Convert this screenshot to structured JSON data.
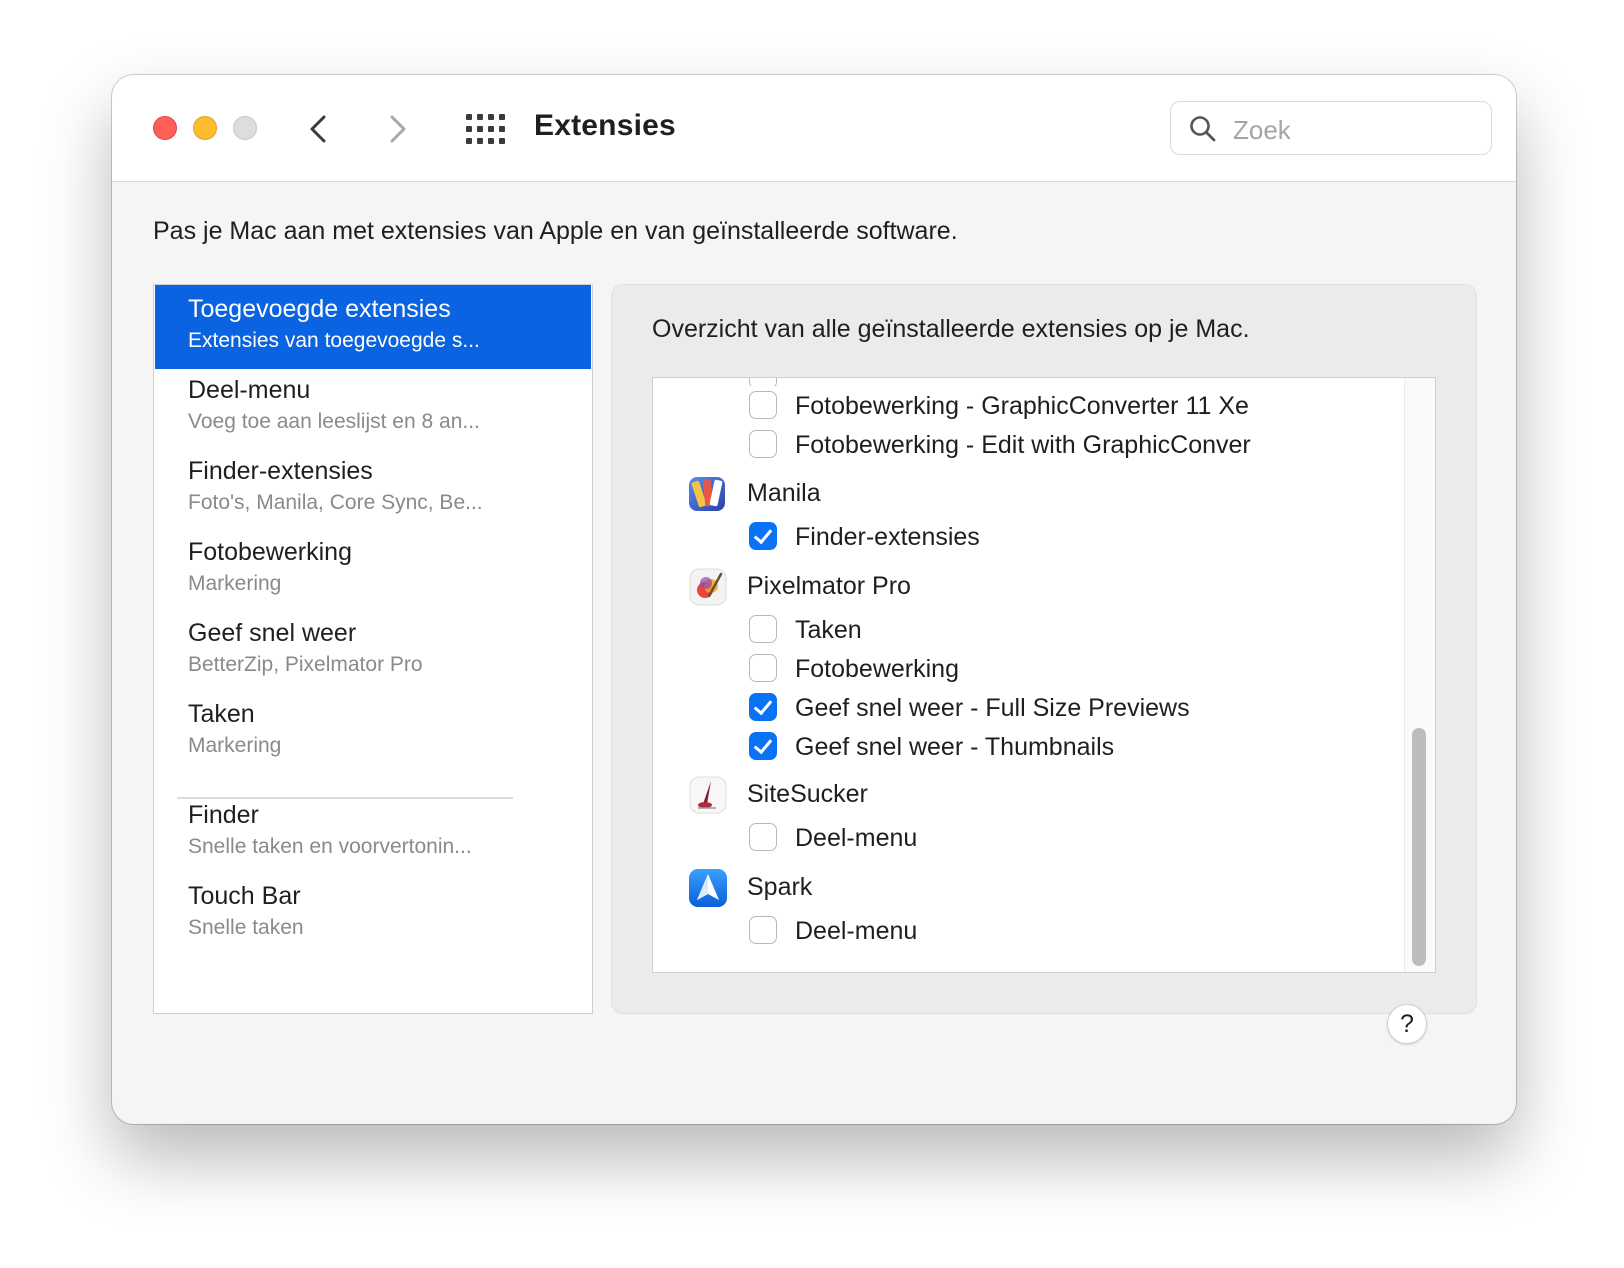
{
  "window": {
    "title": "Extensies"
  },
  "search": {
    "placeholder": "Zoek"
  },
  "description": "Pas je Mac aan met extensies van Apple en van geïnstalleerde software.",
  "sidebar": {
    "items": [
      {
        "title": "Toegevoegde extensies",
        "subtitle": "Extensies van toegevoegde s...",
        "selected": true
      },
      {
        "title": "Deel-menu",
        "subtitle": "Voeg toe aan leeslijst en 8 an..."
      },
      {
        "title": "Finder-extensies",
        "subtitle": "Foto's, Manila, Core Sync, Be..."
      },
      {
        "title": "Fotobewerking",
        "subtitle": "Markering"
      },
      {
        "title": "Geef snel weer",
        "subtitle": "BetterZip, Pixelmator Pro"
      },
      {
        "title": "Taken",
        "subtitle": "Markering"
      }
    ],
    "system_items": [
      {
        "title": "Finder",
        "subtitle": "Snelle taken en voorvertonin..."
      },
      {
        "title": "Touch Bar",
        "subtitle": "Snelle taken"
      }
    ]
  },
  "panel": {
    "title": "Overzicht van alle geïnstalleerde extensies op je Mac.",
    "list": {
      "top_extensions": [
        {
          "label": "Fotobewerking - GraphicConverter 11 Xe",
          "checked": false
        },
        {
          "label": "Fotobewerking - Edit with GraphicConver",
          "checked": false
        }
      ],
      "apps": [
        {
          "name": "Manila",
          "icon": "manila-app-icon",
          "extensions": [
            {
              "label": "Finder-extensies",
              "checked": true
            }
          ]
        },
        {
          "name": "Pixelmator Pro",
          "icon": "pixelmator-pro-app-icon",
          "extensions": [
            {
              "label": "Taken",
              "checked": false
            },
            {
              "label": "Fotobewerking",
              "checked": false
            },
            {
              "label": "Geef snel weer - Full Size Previews",
              "checked": true
            },
            {
              "label": "Geef snel weer - Thumbnails",
              "checked": true
            }
          ]
        },
        {
          "name": "SiteSucker",
          "icon": "sitesucker-app-icon",
          "extensions": [
            {
              "label": "Deel-menu",
              "checked": false
            }
          ]
        },
        {
          "name": "Spark",
          "icon": "spark-app-icon",
          "extensions": [
            {
              "label": "Deel-menu",
              "checked": false
            }
          ]
        }
      ]
    }
  },
  "help": {
    "label": "?"
  },
  "colors": {
    "accent": "#0a63e0",
    "checkbox": "#0a72f5",
    "close": "#fe5f57",
    "minimize": "#febc2e"
  }
}
